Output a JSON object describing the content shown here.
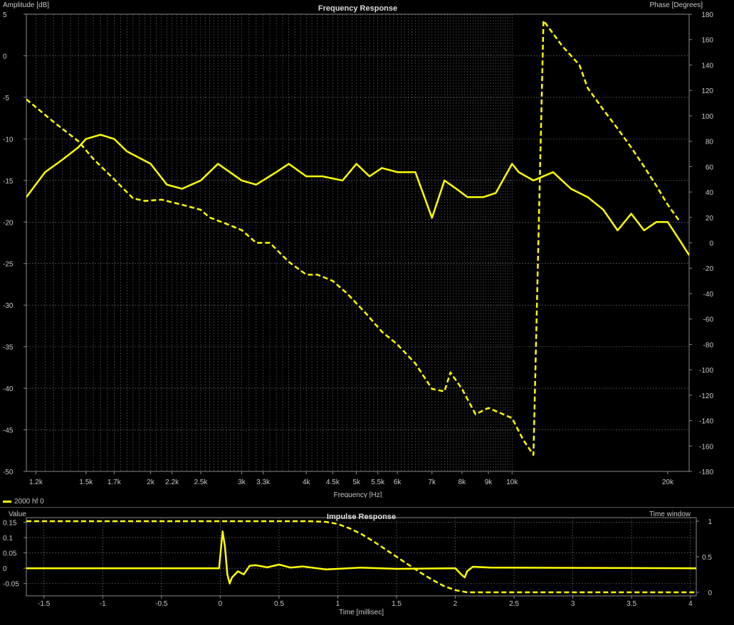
{
  "colors": {
    "background": "#000000",
    "grid": "#8a8a8a",
    "trace": "#ffff00",
    "text": "#c8c8c8"
  },
  "legend": {
    "label": "2000 hf 0"
  },
  "chart_data": [
    {
      "type": "line",
      "title": "Frequency Response",
      "xlabel": "Frequency [Hz]",
      "ylabel": "Amplitude [dB]",
      "y2label": "Phase [Degrees]",
      "x_scale": "log",
      "xlim": [
        1150,
        22000
      ],
      "ylim": [
        -50,
        5
      ],
      "y2lim": [
        -180,
        180
      ],
      "x_ticks": [
        1200,
        1500,
        1700,
        2000,
        2200,
        2500,
        3000,
        3300,
        4000,
        4500,
        5000,
        5500,
        6000,
        7000,
        8000,
        9000,
        10000,
        20000
      ],
      "x_tick_labels": [
        "1.2k",
        "1.5k",
        "1.7k",
        "2k",
        "2.2k",
        "2.5k",
        "3k",
        "3.3k",
        "4k",
        "4.5k",
        "5k",
        "5.5k",
        "6k",
        "7k",
        "8k",
        "9k",
        "10k",
        "20k"
      ],
      "y_ticks": [
        5,
        0,
        -5,
        -10,
        -15,
        -20,
        -25,
        -30,
        -35,
        -40,
        -45,
        -50
      ],
      "y2_ticks": [
        180,
        160,
        140,
        120,
        100,
        80,
        60,
        40,
        20,
        0,
        -20,
        -40,
        -60,
        -80,
        -100,
        -120,
        -140,
        -160,
        -180
      ],
      "grid": true,
      "dense_grid_until_hz": 10000,
      "series": [
        {
          "name": "2000 hf 0",
          "axis": "amplitude",
          "style": "solid",
          "x": [
            1150,
            1250,
            1350,
            1450,
            1500,
            1600,
            1700,
            1800,
            2000,
            2150,
            2300,
            2500,
            2700,
            3000,
            3200,
            3500,
            3700,
            4000,
            4300,
            4700,
            5000,
            5300,
            5600,
            6000,
            6500,
            7000,
            7400,
            7800,
            8200,
            8800,
            9300,
            10000,
            10300,
            11000,
            12000,
            13000,
            14000,
            15000,
            16000,
            17000,
            18000,
            19000,
            20000,
            21000,
            22000
          ],
          "y": [
            -17,
            -14,
            -12.5,
            -11,
            -10,
            -9.5,
            -10,
            -11.5,
            -13,
            -15.5,
            -16,
            -15,
            -13,
            -15,
            -15.5,
            -14,
            -13,
            -14.5,
            -14.5,
            -15,
            -13,
            -14.5,
            -13.5,
            -14,
            -14,
            -19.5,
            -15,
            -16,
            -17,
            -17,
            -16.5,
            -13,
            -14,
            -15,
            -14,
            -16,
            -17,
            -18.5,
            -21,
            -19,
            -21,
            -20,
            -20,
            -22,
            -24
          ]
        },
        {
          "name": "2000 hf 0 (phase)",
          "axis": "phase",
          "style": "dashed",
          "x": [
            1150,
            1300,
            1450,
            1550,
            1700,
            1850,
            1950,
            2100,
            2300,
            2500,
            2600,
            2800,
            3000,
            3200,
            3400,
            3700,
            4000,
            4200,
            4500,
            4800,
            5200,
            5600,
            6000,
            6500,
            7000,
            7400,
            7600,
            8000,
            8500,
            9000,
            10000,
            10500,
            11000,
            11500,
            12500,
            13500,
            14000,
            15000,
            16000,
            17000,
            18000,
            19000,
            20000,
            21000
          ],
          "y": [
            113,
            95,
            80,
            66,
            50,
            35,
            33,
            34,
            30,
            26,
            20,
            15,
            10,
            0,
            0,
            -15,
            -25,
            -25,
            -30,
            -40,
            -55,
            -70,
            -80,
            -95,
            -115,
            -117,
            -102,
            -115,
            -135,
            -130,
            -138,
            -155,
            -167,
            175,
            155,
            140,
            122,
            105,
            90,
            75,
            60,
            45,
            30,
            18
          ]
        }
      ]
    },
    {
      "type": "line",
      "title": "Impulse Response",
      "xlabel": "Time [millisec]",
      "ylabel": "Value",
      "y2label": "Time window",
      "xlim": [
        -1.65,
        4.05
      ],
      "ylim": [
        -0.09,
        0.165
      ],
      "y2lim": [
        -0.05,
        1.05
      ],
      "x_ticks": [
        -1.5,
        -1,
        -0.5,
        0,
        0.5,
        1,
        1.5,
        2,
        2.5,
        3,
        3.5,
        4
      ],
      "x_tick_labels": [
        "-1.5",
        "-1",
        "-0.5",
        "0",
        "0.5",
        "1",
        "1.5",
        "2",
        "2.5",
        "3",
        "3.5",
        "4"
      ],
      "y_ticks": [
        0.15,
        0.1,
        0.05,
        0,
        -0.05
      ],
      "y_tick_labels": [
        "0.15",
        "0.1",
        "0.05",
        "0",
        "-0.05"
      ],
      "y2_ticks": [
        1,
        0.5,
        0
      ],
      "grid": true,
      "series": [
        {
          "name": "impulse",
          "axis": "value",
          "style": "solid",
          "x": [
            -1.65,
            -0.01,
            0,
            0.02,
            0.04,
            0.06,
            0.08,
            0.1,
            0.15,
            0.2,
            0.25,
            0.3,
            0.4,
            0.5,
            0.6,
            0.7,
            0.9,
            1.2,
            1.5,
            2.0,
            2.05,
            2.08,
            2.1,
            2.15,
            2.3,
            4.05
          ],
          "y": [
            0,
            0,
            0.04,
            0.12,
            0.07,
            -0.02,
            -0.05,
            -0.03,
            -0.01,
            -0.02,
            0.008,
            0.01,
            0.003,
            0.012,
            0.002,
            0.006,
            -0.004,
            0.002,
            -0.002,
            0,
            -0.02,
            -0.03,
            -0.01,
            0.005,
            0.002,
            0
          ]
        },
        {
          "name": "window",
          "axis": "window",
          "style": "dashed",
          "x": [
            -1.65,
            0.75,
            0.9,
            1.0,
            1.1,
            1.2,
            1.3,
            1.4,
            1.5,
            1.6,
            1.7,
            1.8,
            1.9,
            2.0,
            2.1,
            4.05
          ],
          "y": [
            1,
            1,
            0.99,
            0.96,
            0.9,
            0.82,
            0.72,
            0.61,
            0.5,
            0.39,
            0.28,
            0.18,
            0.09,
            0.03,
            0,
            0
          ]
        }
      ]
    }
  ]
}
